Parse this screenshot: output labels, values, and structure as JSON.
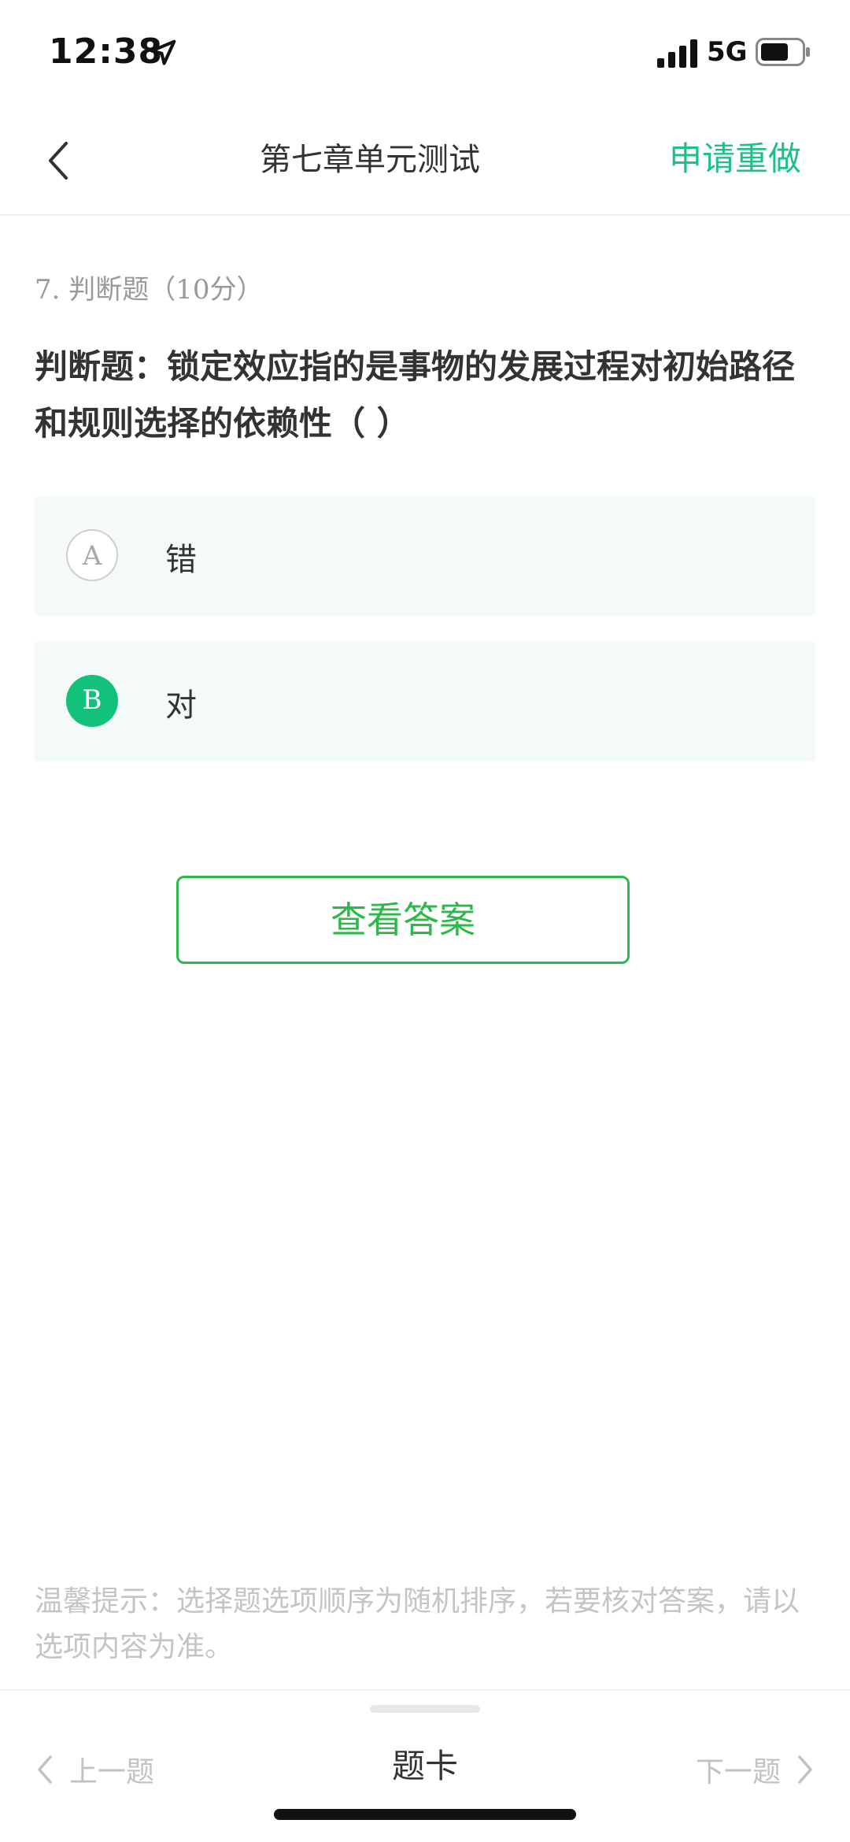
{
  "status_bar": {
    "time": "12:38",
    "network": "5G"
  },
  "nav": {
    "title": "第七章单元测试",
    "redo_label": "申请重做"
  },
  "question": {
    "meta": "7. 判断题（10分）",
    "text": "判断题：锁定效应指的是事物的发展过程对初始路径和规则选择的依赖性（ ）",
    "options": [
      {
        "letter": "A",
        "label": "错",
        "selected": false
      },
      {
        "letter": "B",
        "label": "对",
        "selected": true
      }
    ]
  },
  "view_answer_label": "查看答案",
  "tip": "温馨提示：选择题选项顺序为随机排序，若要核对答案，请以选项内容为准。",
  "bottom_bar": {
    "prev_label": "上一题",
    "card_label": "题卡",
    "next_label": "下一题"
  },
  "colors": {
    "accent_teal": "#1ec08a",
    "selected_green": "#12c27a",
    "button_green": "#2db84a"
  }
}
